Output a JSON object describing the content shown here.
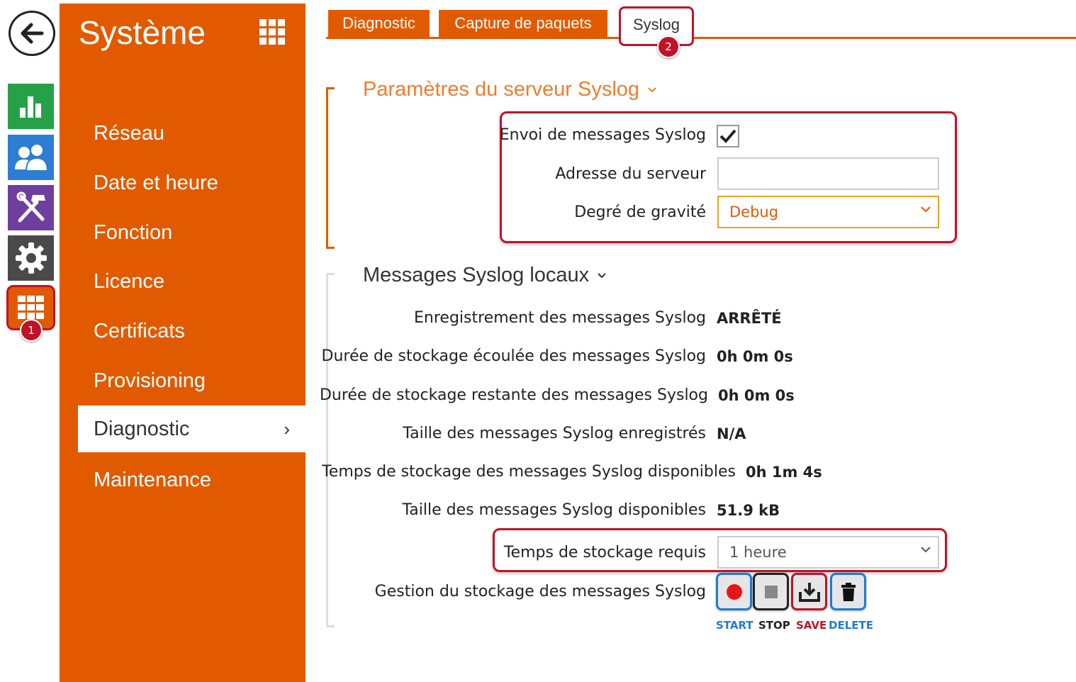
{
  "rail": {
    "back_icon": "arrow-left-icon",
    "items": [
      {
        "name": "status",
        "icon": "bar-chart-icon",
        "color": "#27a148"
      },
      {
        "name": "directory",
        "icon": "users-icon",
        "color": "#2d7dd2"
      },
      {
        "name": "hardware",
        "icon": "tools-icon",
        "color": "#6f3e9f"
      },
      {
        "name": "services",
        "icon": "gear-icon",
        "color": "#4a4a4a"
      },
      {
        "name": "system",
        "icon": "grid-icon",
        "color": "#e25a00"
      }
    ],
    "badge": "1"
  },
  "sidebar": {
    "title": "Système",
    "color": "#e25a00",
    "items": [
      {
        "label": "Réseau"
      },
      {
        "label": "Date et heure"
      },
      {
        "label": "Fonction"
      },
      {
        "label": "Licence"
      },
      {
        "label": "Certificats"
      },
      {
        "label": "Provisioning"
      },
      {
        "label": "Diagnostic",
        "active": true,
        "chevron": "›"
      },
      {
        "label": "Maintenance"
      }
    ]
  },
  "tabs": {
    "items": [
      {
        "label": "Diagnostic"
      },
      {
        "label": "Capture de paquets"
      },
      {
        "label": "Syslog",
        "active": true
      }
    ],
    "badge": "2"
  },
  "server_section": {
    "title": "Paramètres du serveur Syslog",
    "send_label": "Envoi de messages Syslog",
    "send_checked": true,
    "address_label": "Adresse du serveur",
    "address_value": "",
    "severity_label": "Degré de gravité",
    "severity_value": "Debug"
  },
  "local_section": {
    "title": "Messages Syslog locaux",
    "rows": [
      {
        "label": "Enregistrement des messages Syslog",
        "value": "ARRÊTÉ"
      },
      {
        "label": "Durée de stockage écoulée des messages Syslog",
        "value": "0h 0m 0s"
      },
      {
        "label": "Durée de stockage restante des messages Syslog",
        "value": "0h 0m 0s"
      },
      {
        "label": "Taille des messages Syslog enregistrés",
        "value": "N/A"
      },
      {
        "label": "Temps de stockage des messages Syslog disponibles",
        "value": "0h 1m 4s"
      },
      {
        "label": "Taille des messages Syslog disponibles",
        "value": "51.9 kB"
      }
    ],
    "required_time_label": "Temps de stockage requis",
    "required_time_value": "1 heure",
    "management_label": "Gestion du stockage des messages Syslog",
    "buttons": {
      "start": "START",
      "stop": "STOP",
      "save": "SAVE",
      "delete": "DELETE"
    }
  },
  "colors": {
    "accent": "#e25a00",
    "highlight": "#c0132a",
    "link_blue": "#1f7ad6"
  }
}
